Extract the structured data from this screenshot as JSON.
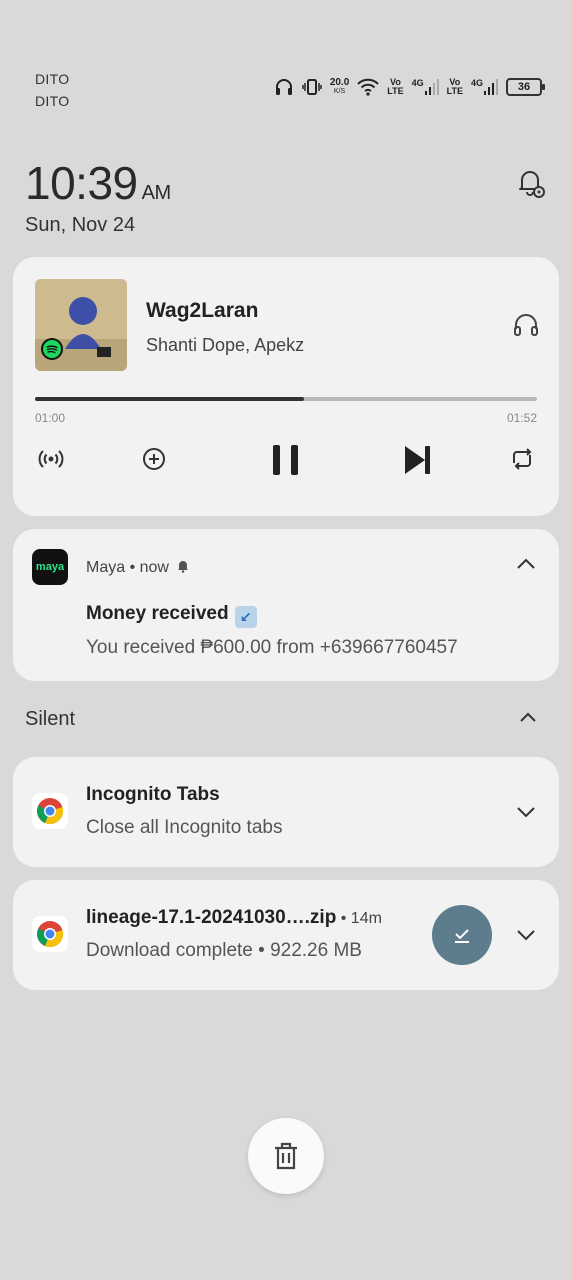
{
  "status_bar": {
    "carrier1": "DITO",
    "carrier2": "DITO",
    "speed_value": "20.0",
    "speed_unit": "K/S",
    "sim1_vo": "Vo",
    "sim1_lte": "LTE",
    "sim1_gen": "4G",
    "sim2_vo": "Vo",
    "sim2_lte": "LTE",
    "sim2_gen": "4G",
    "battery": "36",
    "icons": [
      "headphones-icon",
      "vibrate-icon",
      "wifi-icon",
      "signal-icon",
      "battery-icon"
    ]
  },
  "header": {
    "time": "10:39",
    "ampm": "AM",
    "date": "Sun, Nov 24",
    "settings_icon": "notification-settings-icon"
  },
  "media": {
    "title": "Wag2Laran",
    "artist": "Shanti Dope, Apekz",
    "elapsed": "01:00",
    "total": "01:52",
    "progress": 0.536,
    "controls": [
      "broadcast-icon",
      "add-icon",
      "pause-icon",
      "skip-next-icon",
      "repeat-icon"
    ],
    "source_app": "spotify"
  },
  "maya": {
    "app_name": "Maya",
    "when": "now",
    "logo_text": "maya",
    "title": "Money received",
    "title_emoji": "↙",
    "text": "You received ₱600.00 from +639667760457"
  },
  "silent_section": {
    "label": "Silent"
  },
  "incognito": {
    "title": "Incognito Tabs",
    "text": "Close all Incognito tabs"
  },
  "download": {
    "title": "lineage-17.1-20241030….zip",
    "meta": " • 14m",
    "text": "Download complete • 922.26 MB"
  },
  "colors": {
    "background": "#d9d9d9",
    "card": "#f2f2f2",
    "maya_green": "#2de38b",
    "action_button": "#5d7c8c"
  }
}
